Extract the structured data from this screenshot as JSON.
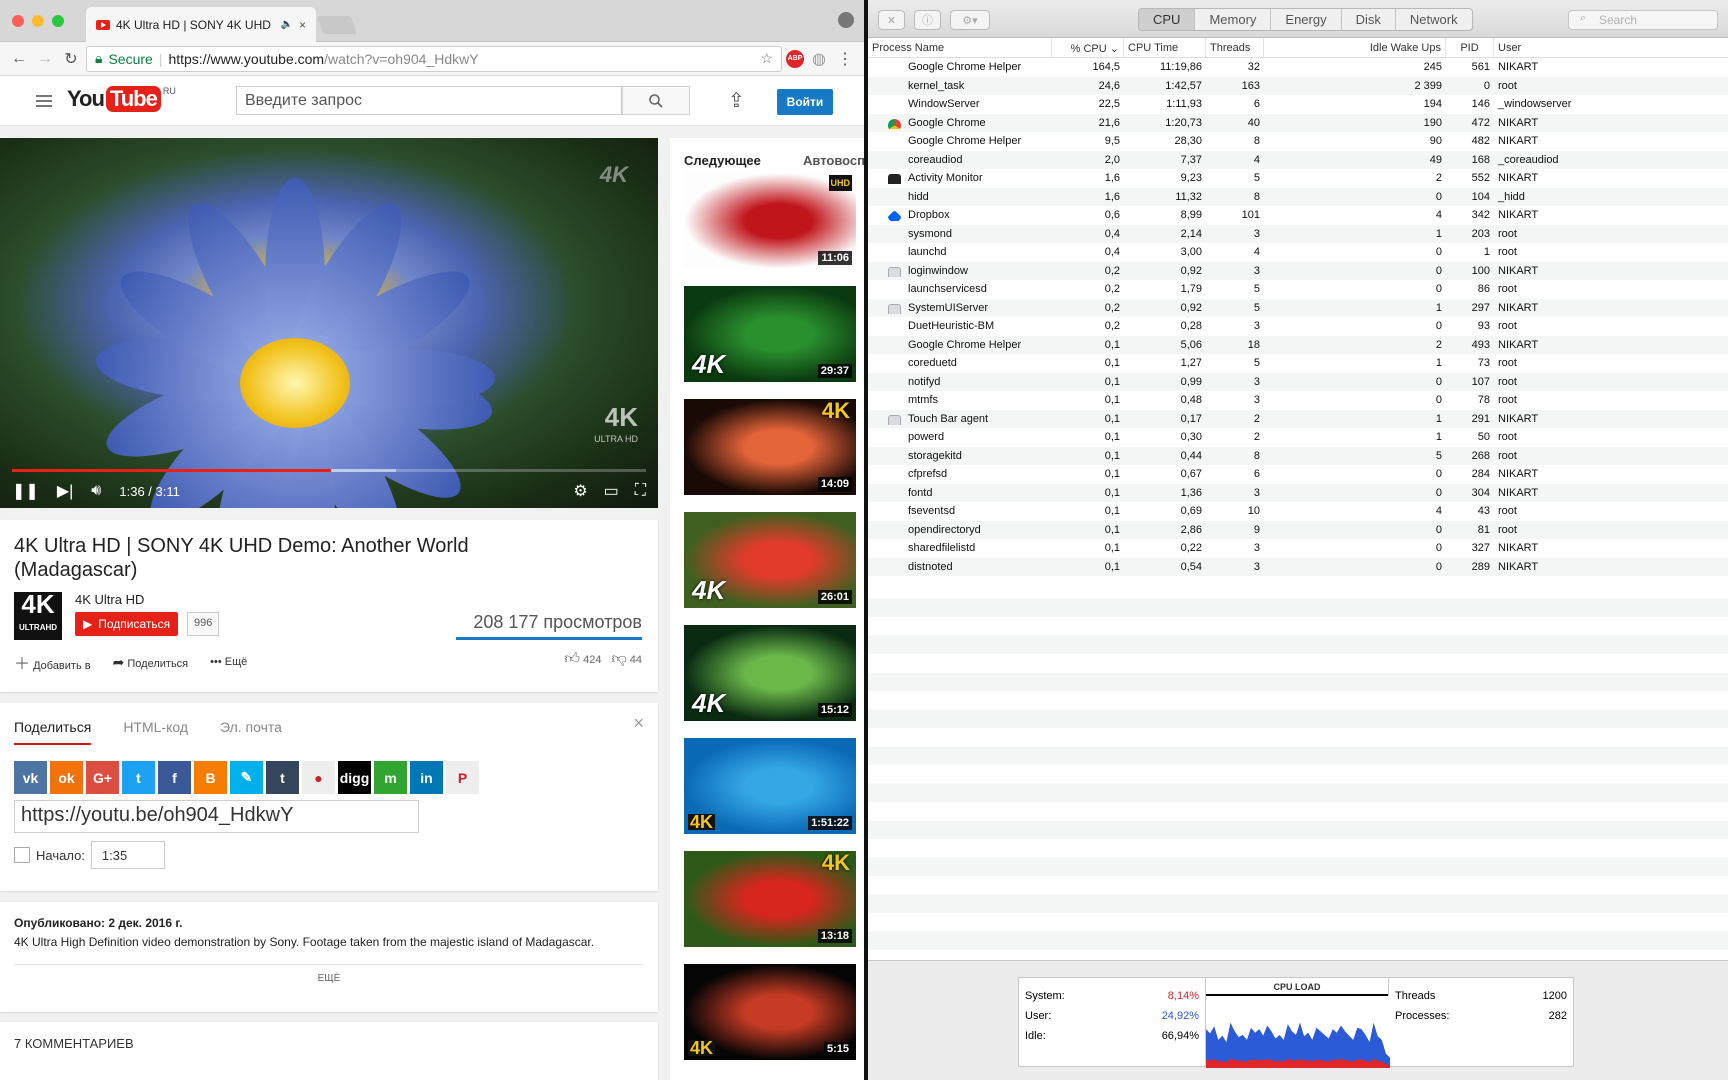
{
  "browser": {
    "tab_title": "4K Ultra HD | SONY 4K UHD",
    "secure_label": "Secure",
    "url_host": "https://www.youtube.com",
    "url_path": "/watch?v=oh904_HdkwY",
    "abp_label": "ABP"
  },
  "youtube": {
    "logo_you": "You",
    "logo_tube": "Tube",
    "logo_region": "RU",
    "search_placeholder": "Введите запрос",
    "signin_label": "Войти",
    "player": {
      "watermark": "4K",
      "watermark_sub": "ULTRA HD",
      "time": "1:36 / 3:11",
      "played_fraction": 0.503,
      "loaded_fraction": 0.605
    },
    "video_title": "4K Ultra HD | SONY 4K UHD Demo: Another World (Madagascar)",
    "channel_logo": "4K",
    "channel_logo_sub": "ULTRAHD",
    "channel_name": "4K Ultra HD",
    "subscribe_label": "Подписаться",
    "subscriber_count": "996",
    "views": "208 177 просмотров",
    "add_to_label": "Добавить в",
    "share_label": "Поделиться",
    "more_actions_label": "Ещё",
    "likes": "424",
    "dislikes": "44",
    "share_tabs": [
      "Поделиться",
      "HTML-код",
      "Эл. почта"
    ],
    "social_networks": [
      {
        "name": "vk",
        "glyph": "vk",
        "color": "#4c75a3"
      },
      {
        "name": "odnoklassniki",
        "glyph": "ok",
        "color": "#f2720c"
      },
      {
        "name": "google-plus",
        "glyph": "G+",
        "color": "#dc4e41"
      },
      {
        "name": "twitter",
        "glyph": "t",
        "color": "#1da1f2"
      },
      {
        "name": "facebook",
        "glyph": "f",
        "color": "#3b5998"
      },
      {
        "name": "blogger",
        "glyph": "B",
        "color": "#f57d00"
      },
      {
        "name": "livejournal",
        "glyph": "✎",
        "color": "#00b0ea"
      },
      {
        "name": "tumblr",
        "glyph": "t",
        "color": "#35465c"
      },
      {
        "name": "reddit",
        "glyph": "●",
        "color": "#eeeeee"
      },
      {
        "name": "digg",
        "glyph": "digg",
        "color": "#000000"
      },
      {
        "name": "mixi",
        "glyph": "m",
        "color": "#32a430"
      },
      {
        "name": "linkedin",
        "glyph": "in",
        "color": "#0077b5"
      },
      {
        "name": "pinterest",
        "glyph": "P",
        "color": "#eeeeee"
      }
    ],
    "share_url": "https://youtu.be/oh904_HdkwY",
    "start_label": "Начало:",
    "start_time": "1:35",
    "published": "Опубликовано: 2 дек. 2016 г.",
    "description": "4K Ultra High Definition video demonstration by Sony. Footage taken from the majestic island of Madagascar.",
    "show_more": "ЕЩЁ",
    "comments_header": "7 КОММЕНТАРИЕВ",
    "up_next_label": "Следующее",
    "autoplay_label": "Автовоспроизведение",
    "recommendations": [
      {
        "duration": "11:06",
        "badge": "UHD",
        "bg": "#fdfdfd",
        "accent": "#c0151b"
      },
      {
        "duration": "29:37",
        "badge": "4K",
        "bg": "#0b3a10",
        "accent": "#2a8f2e"
      },
      {
        "duration": "14:09",
        "badge": "4K",
        "bg": "#1a0a05",
        "accent": "#e4643a"
      },
      {
        "duration": "26:01",
        "badge": "4K",
        "bg": "#3f6020",
        "accent": "#e23b2b"
      },
      {
        "duration": "15:12",
        "badge": "4K",
        "bg": "#0a2b12",
        "accent": "#6bb74a"
      },
      {
        "duration": "1:51:22",
        "badge": "4K",
        "bg": "#0b6ab5",
        "accent": "#35a7e5"
      },
      {
        "duration": "13:18",
        "badge": "4K",
        "bg": "#2d5a18",
        "accent": "#d8261e"
      },
      {
        "duration": "5:15",
        "badge": "4K",
        "bg": "#050505",
        "accent": "#c53b24"
      }
    ]
  },
  "activity_monitor": {
    "tabs": [
      "CPU",
      "Memory",
      "Energy",
      "Disk",
      "Network"
    ],
    "search_placeholder": "Search",
    "columns": [
      "Process Name",
      "% CPU",
      "CPU Time",
      "Threads",
      "Idle Wake Ups",
      "PID",
      "User"
    ],
    "processes": [
      {
        "name": "Google Chrome Helper",
        "cpu": "164,5",
        "time": "11:19,86",
        "threads": "32",
        "idle": "245",
        "pid": "561",
        "user": "NIKART",
        "icon": ""
      },
      {
        "name": "kernel_task",
        "cpu": "24,6",
        "time": "1:42,57",
        "threads": "163",
        "idle": "2 399",
        "pid": "0",
        "user": "root",
        "icon": ""
      },
      {
        "name": "WindowServer",
        "cpu": "22,5",
        "time": "1:11,93",
        "threads": "6",
        "idle": "194",
        "pid": "146",
        "user": "_windowserver",
        "icon": ""
      },
      {
        "name": "Google Chrome",
        "cpu": "21,6",
        "time": "1:20,73",
        "threads": "40",
        "idle": "190",
        "pid": "472",
        "user": "NIKART",
        "icon": "chrome"
      },
      {
        "name": "Google Chrome Helper",
        "cpu": "9,5",
        "time": "28,30",
        "threads": "8",
        "idle": "90",
        "pid": "482",
        "user": "NIKART",
        "icon": ""
      },
      {
        "name": "coreaudiod",
        "cpu": "2,0",
        "time": "7,37",
        "threads": "4",
        "idle": "49",
        "pid": "168",
        "user": "_coreaudiod",
        "icon": ""
      },
      {
        "name": "Activity Monitor",
        "cpu": "1,6",
        "time": "9,23",
        "threads": "5",
        "idle": "2",
        "pid": "552",
        "user": "NIKART",
        "icon": "activity"
      },
      {
        "name": "hidd",
        "cpu": "1,6",
        "time": "11,32",
        "threads": "8",
        "idle": "0",
        "pid": "104",
        "user": "_hidd",
        "icon": ""
      },
      {
        "name": "Dropbox",
        "cpu": "0,6",
        "time": "8,99",
        "threads": "101",
        "idle": "4",
        "pid": "342",
        "user": "NIKART",
        "icon": "dropbox"
      },
      {
        "name": "sysmond",
        "cpu": "0,4",
        "time": "2,14",
        "threads": "3",
        "idle": "1",
        "pid": "203",
        "user": "root",
        "icon": ""
      },
      {
        "name": "launchd",
        "cpu": "0,4",
        "time": "3,00",
        "threads": "4",
        "idle": "0",
        "pid": "1",
        "user": "root",
        "icon": ""
      },
      {
        "name": "loginwindow",
        "cpu": "0,2",
        "time": "0,92",
        "threads": "3",
        "idle": "0",
        "pid": "100",
        "user": "NIKART",
        "icon": "generic"
      },
      {
        "name": "launchservicesd",
        "cpu": "0,2",
        "time": "1,79",
        "threads": "5",
        "idle": "0",
        "pid": "86",
        "user": "root",
        "icon": ""
      },
      {
        "name": "SystemUIServer",
        "cpu": "0,2",
        "time": "0,92",
        "threads": "5",
        "idle": "1",
        "pid": "297",
        "user": "NIKART",
        "icon": "generic"
      },
      {
        "name": "DuetHeuristic-BM",
        "cpu": "0,2",
        "time": "0,28",
        "threads": "3",
        "idle": "0",
        "pid": "93",
        "user": "root",
        "icon": ""
      },
      {
        "name": "Google Chrome Helper",
        "cpu": "0,1",
        "time": "5,06",
        "threads": "18",
        "idle": "2",
        "pid": "493",
        "user": "NIKART",
        "icon": ""
      },
      {
        "name": "coreduetd",
        "cpu": "0,1",
        "time": "1,27",
        "threads": "5",
        "idle": "1",
        "pid": "73",
        "user": "root",
        "icon": ""
      },
      {
        "name": "notifyd",
        "cpu": "0,1",
        "time": "0,99",
        "threads": "3",
        "idle": "0",
        "pid": "107",
        "user": "root",
        "icon": ""
      },
      {
        "name": "mtmfs",
        "cpu": "0,1",
        "time": "0,48",
        "threads": "3",
        "idle": "0",
        "pid": "78",
        "user": "root",
        "icon": ""
      },
      {
        "name": "Touch Bar agent",
        "cpu": "0,1",
        "time": "0,17",
        "threads": "2",
        "idle": "1",
        "pid": "291",
        "user": "NIKART",
        "icon": "generic"
      },
      {
        "name": "powerd",
        "cpu": "0,1",
        "time": "0,30",
        "threads": "2",
        "idle": "1",
        "pid": "50",
        "user": "root",
        "icon": ""
      },
      {
        "name": "storagekitd",
        "cpu": "0,1",
        "time": "0,44",
        "threads": "8",
        "idle": "5",
        "pid": "268",
        "user": "root",
        "icon": ""
      },
      {
        "name": "cfprefsd",
        "cpu": "0,1",
        "time": "0,67",
        "threads": "6",
        "idle": "0",
        "pid": "284",
        "user": "NIKART",
        "icon": ""
      },
      {
        "name": "fontd",
        "cpu": "0,1",
        "time": "1,36",
        "threads": "3",
        "idle": "0",
        "pid": "304",
        "user": "NIKART",
        "icon": ""
      },
      {
        "name": "fseventsd",
        "cpu": "0,1",
        "time": "0,69",
        "threads": "10",
        "idle": "4",
        "pid": "43",
        "user": "root",
        "icon": ""
      },
      {
        "name": "opendirectoryd",
        "cpu": "0,1",
        "time": "2,86",
        "threads": "9",
        "idle": "0",
        "pid": "81",
        "user": "root",
        "icon": ""
      },
      {
        "name": "sharedfilelistd",
        "cpu": "0,1",
        "time": "0,22",
        "threads": "3",
        "idle": "0",
        "pid": "327",
        "user": "NIKART",
        "icon": ""
      },
      {
        "name": "distnoted",
        "cpu": "0,1",
        "time": "0,54",
        "threads": "3",
        "idle": "0",
        "pid": "289",
        "user": "NIKART",
        "icon": ""
      }
    ],
    "summary": {
      "system_label": "System:",
      "system_value": "8,14%",
      "system_color": "#e0262a",
      "user_label": "User:",
      "user_value": "24,92%",
      "user_color": "#2b5bd7",
      "idle_label": "Idle:",
      "idle_value": "66,94%",
      "graph_title": "CPU LOAD",
      "threads_label": "Threads",
      "threads_value": "1200",
      "processes_label": "Processes:",
      "processes_value": "282",
      "user_load_series": [
        0.42,
        0.38,
        0.45,
        0.3,
        0.35,
        0.28,
        0.5,
        0.4,
        0.33,
        0.36,
        0.3,
        0.44,
        0.38,
        0.42,
        0.35,
        0.46,
        0.4,
        0.32,
        0.36,
        0.3,
        0.48,
        0.4,
        0.36,
        0.5,
        0.34,
        0.38,
        0.3,
        0.44,
        0.4,
        0.36,
        0.32,
        0.42,
        0.38,
        0.46,
        0.4,
        0.35,
        0.3,
        0.44,
        0.42,
        0.36,
        0.28,
        0.5,
        0.34,
        0.3,
        0.15,
        0.1
      ],
      "system_load_series": [
        0.12,
        0.1,
        0.13,
        0.09,
        0.1,
        0.08,
        0.13,
        0.11,
        0.1,
        0.1,
        0.09,
        0.12,
        0.11,
        0.12,
        0.1,
        0.13,
        0.11,
        0.09,
        0.1,
        0.09,
        0.13,
        0.11,
        0.1,
        0.13,
        0.1,
        0.11,
        0.09,
        0.12,
        0.11,
        0.1,
        0.09,
        0.12,
        0.11,
        0.13,
        0.11,
        0.1,
        0.09,
        0.12,
        0.12,
        0.1,
        0.08,
        0.13,
        0.1,
        0.09,
        0.05,
        0.04
      ]
    }
  }
}
